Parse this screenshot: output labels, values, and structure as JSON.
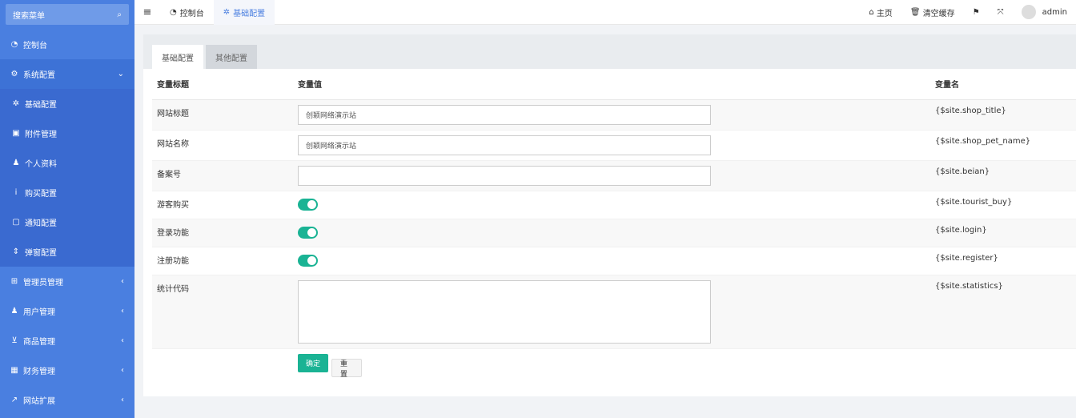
{
  "sidebar": {
    "search_label": "搜索菜单",
    "search_icon": "search-icon",
    "items": [
      {
        "label": "控制台",
        "icon": "dashboard-icon"
      },
      {
        "label": "系统配置",
        "icon": "cogs-icon"
      },
      {
        "label": "管理员管理",
        "icon": "windows-icon"
      },
      {
        "label": "用户管理",
        "icon": "user-icon"
      },
      {
        "label": "商品管理",
        "icon": "cart-icon"
      },
      {
        "label": "财务管理",
        "icon": "finance-icon"
      },
      {
        "label": "网站扩展",
        "icon": "external-link-icon"
      }
    ],
    "sub_items": [
      {
        "label": "基础配置",
        "icon": "gear-icon"
      },
      {
        "label": "附件管理",
        "icon": "file-icon"
      },
      {
        "label": "个人资料",
        "icon": "user-icon"
      },
      {
        "label": "购买配置",
        "icon": "info-icon"
      },
      {
        "label": "通知配置",
        "icon": "chat-icon"
      },
      {
        "label": "弹窗配置",
        "icon": "sort-icon"
      }
    ]
  },
  "topbar": {
    "tabs": [
      {
        "label": "控制台",
        "icon": "dashboard-icon"
      },
      {
        "label": "基础配置",
        "icon": "gear-icon"
      }
    ],
    "home": "主页",
    "clear_cache": "清空缓存",
    "user": "admin"
  },
  "card": {
    "tabs": [
      "基础配置",
      "其他配置"
    ],
    "headers": {
      "title": "变量标题",
      "value": "变量值",
      "name": "变量名"
    },
    "rows": [
      {
        "title": "网站标题",
        "value": "创颖网络演示站",
        "name": "{$site.shop_title}",
        "type": "input"
      },
      {
        "title": "网站名称",
        "value": "创颖网络演示站",
        "name": "{$site.shop_pet_name}",
        "type": "input"
      },
      {
        "title": "备案号",
        "value": "",
        "name": "{$site.beian}",
        "type": "input"
      },
      {
        "title": "游客购买",
        "value": "on",
        "name": "{$site.tourist_buy}",
        "type": "toggle"
      },
      {
        "title": "登录功能",
        "value": "on",
        "name": "{$site.login}",
        "type": "toggle"
      },
      {
        "title": "注册功能",
        "value": "on",
        "name": "{$site.register}",
        "type": "toggle"
      },
      {
        "title": "统计代码",
        "value": "",
        "name": "{$site.statistics}",
        "type": "textarea"
      }
    ],
    "confirm": "确定",
    "reset": "重置"
  },
  "colors": {
    "sidebar": "#4a7fe0",
    "accent": "#1ab394"
  }
}
